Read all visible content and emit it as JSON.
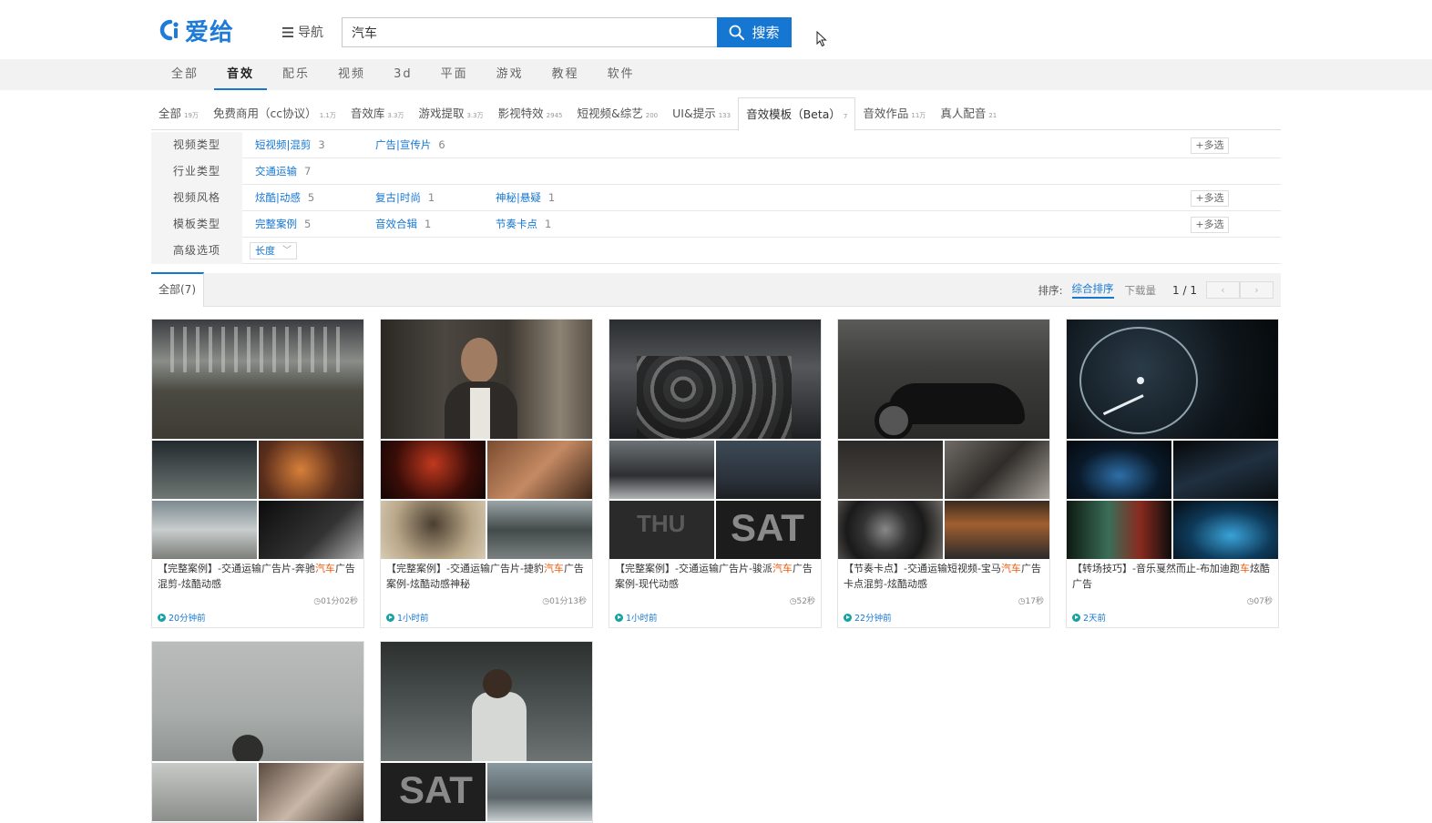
{
  "header": {
    "logo_text": "爱给",
    "nav_label": "导航",
    "search_value": "汽车",
    "search_button": "搜索"
  },
  "categories": [
    {
      "label": "全部",
      "active": false
    },
    {
      "label": "音效",
      "active": true
    },
    {
      "label": "配乐",
      "active": false
    },
    {
      "label": "视频",
      "active": false
    },
    {
      "label": "3d",
      "active": false
    },
    {
      "label": "平面",
      "active": false
    },
    {
      "label": "游戏",
      "active": false
    },
    {
      "label": "教程",
      "active": false
    },
    {
      "label": "软件",
      "active": false
    }
  ],
  "sub_tabs": [
    {
      "label": "全部",
      "count": "19万"
    },
    {
      "label": "免费商用（cc协议）",
      "count": "1.1万"
    },
    {
      "label": "音效库",
      "count": "3.3万"
    },
    {
      "label": "游戏提取",
      "count": "3.3万"
    },
    {
      "label": "影视特效",
      "count": "2945"
    },
    {
      "label": "短视频&综艺",
      "count": "200"
    },
    {
      "label": "UI&提示",
      "count": "133"
    },
    {
      "label": "音效模板（Beta）",
      "count": "7",
      "active": true
    },
    {
      "label": "音效作品",
      "count": "11万"
    },
    {
      "label": "真人配音",
      "count": "21"
    }
  ],
  "filters": [
    {
      "label": "视频类型",
      "options": [
        {
          "name": "短视频|混剪",
          "count": "3"
        },
        {
          "name": "广告|宣传片",
          "count": "6"
        }
      ],
      "multi": "+多选"
    },
    {
      "label": "行业类型",
      "options": [
        {
          "name": "交通运输",
          "count": "7"
        }
      ]
    },
    {
      "label": "视频风格",
      "options": [
        {
          "name": "炫酷|动感",
          "count": "5"
        },
        {
          "name": "复古|时尚",
          "count": "1"
        },
        {
          "name": "神秘|悬疑",
          "count": "1"
        }
      ],
      "multi": "+多选"
    },
    {
      "label": "模板类型",
      "options": [
        {
          "name": "完整案例",
          "count": "5"
        },
        {
          "name": "音效合辑",
          "count": "1"
        },
        {
          "name": "节奏卡点",
          "count": "1"
        }
      ],
      "multi": "+多选"
    },
    {
      "label": "高级选项",
      "select": "长度"
    }
  ],
  "results": {
    "all_tab": "全部(7)",
    "sort_label": "排序:",
    "sort_options": [
      "综合排序",
      "下载量"
    ],
    "pager": "1 / 1",
    "prev": "‹",
    "next": "›"
  },
  "cards": [
    {
      "title_pre": "【完整案例】-交通运输广告片-奔驰",
      "title_hl": "汽车",
      "title_post": "广告混剪-炫酷动感",
      "duration": "01分02秒",
      "time": "20分钟前"
    },
    {
      "title_pre": "【完整案例】-交通运输广告片-捷豹",
      "title_hl": "汽车",
      "title_post": "广告案例-炫酷动感神秘",
      "duration": "01分13秒",
      "time": "1小时前"
    },
    {
      "title_pre": "【完整案例】-交通运输广告片-骏派",
      "title_hl": "汽车",
      "title_post": "广告案例-现代动感",
      "duration": "52秒",
      "time": "1小时前"
    },
    {
      "title_pre": "【节奏卡点】-交通运输短视频-宝马",
      "title_hl": "汽车",
      "title_post": "广告卡点混剪-炫酷动感",
      "duration": "17秒",
      "time": "22分钟前"
    },
    {
      "title_pre": "【转场技巧】-音乐戛然而止-布加迪跑",
      "title_hl": "车",
      "title_post": "炫酷广告",
      "duration": "07秒",
      "time": "2天前"
    }
  ],
  "thumb_text": {
    "thu": "THU",
    "sat": "SAT"
  },
  "colors": {
    "accent": "#1677d2",
    "highlight": "#e8590c"
  }
}
